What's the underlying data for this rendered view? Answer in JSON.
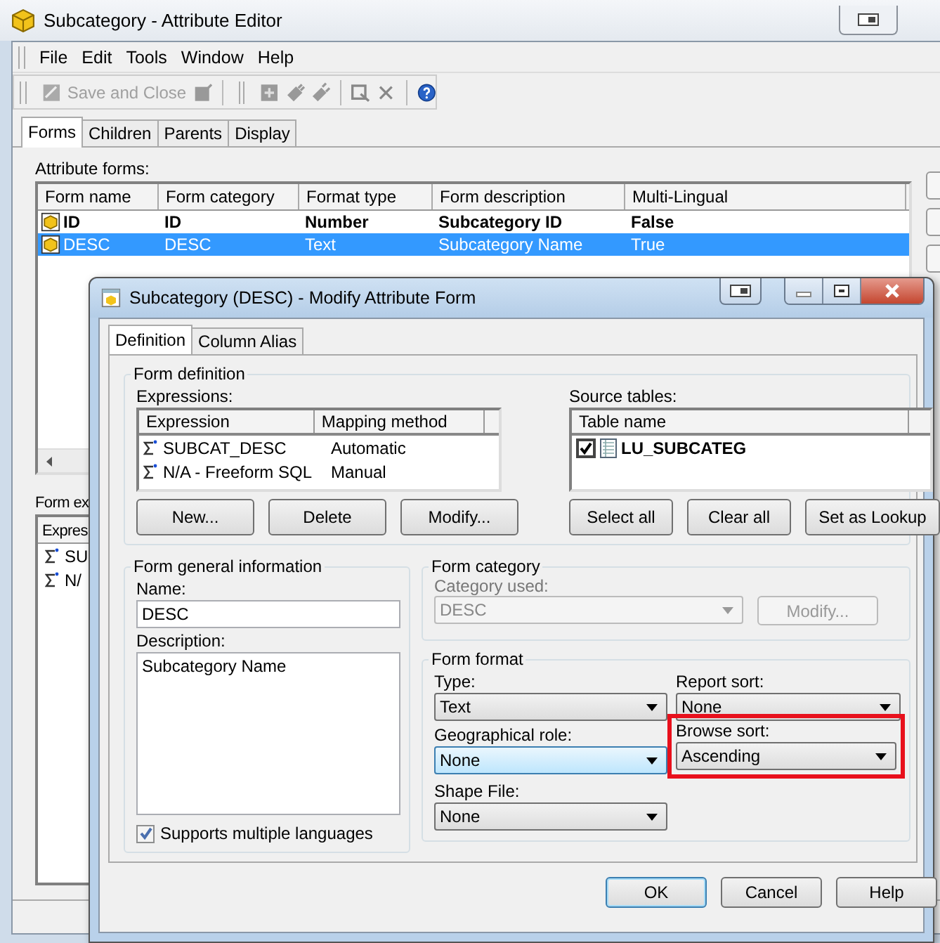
{
  "main_window": {
    "title": "Subcategory - Attribute Editor"
  },
  "menu": [
    "File",
    "Edit",
    "Tools",
    "Window",
    "Help"
  ],
  "toolbar": {
    "save_label": "Save and Close",
    "save_disabled": true
  },
  "tabs": [
    {
      "label": "Forms",
      "selected": true
    },
    {
      "label": "Children",
      "selected": false
    },
    {
      "label": "Parents",
      "selected": false
    },
    {
      "label": "Display",
      "selected": false
    }
  ],
  "attribute_forms": {
    "label": "Attribute forms:",
    "columns": [
      "Form name",
      "Form category",
      "Format type",
      "Form description",
      "Multi-Lingual"
    ],
    "rows": [
      {
        "cells": [
          "ID",
          "ID",
          "Number",
          "Subcategory ID",
          "False"
        ],
        "bold": true,
        "selected": false
      },
      {
        "cells": [
          "DESC",
          "DESC",
          "Text",
          "Subcategory Name",
          "True"
        ],
        "bold": false,
        "selected": true
      }
    ]
  },
  "form_expressions": {
    "label": "Form ex",
    "column": "Expres",
    "rows": [
      "SU",
      "N/"
    ]
  },
  "dialog": {
    "title": "Subcategory (DESC) - Modify Attribute Form",
    "tabs": [
      {
        "label": "Definition",
        "selected": true
      },
      {
        "label": "Column Alias",
        "selected": false
      }
    ],
    "form_definition": {
      "legend": "Form definition",
      "expressions_label": "Expressions:",
      "columns": [
        "Expression",
        "Mapping method"
      ],
      "rows": [
        {
          "expression": "SUBCAT_DESC",
          "method": "Automatic"
        },
        {
          "expression": "N/A - Freeform SQL",
          "method": "Manual"
        }
      ],
      "buttons": [
        "New...",
        "Delete",
        "Modify..."
      ],
      "source_label": "Source tables:",
      "source_column": "Table name",
      "tables": [
        {
          "name": "LU_SUBCATEG",
          "checked": true
        }
      ],
      "source_buttons": [
        "Select all",
        "Clear all",
        "Set as Lookup"
      ]
    },
    "general": {
      "legend": "Form general information",
      "name_label": "Name:",
      "name": "DESC",
      "description_label": "Description:",
      "description": "Subcategory Name",
      "multilang_label": "Supports multiple languages",
      "multilang_checked": true
    },
    "category": {
      "legend": "Form category",
      "label": "Category used:",
      "value": "DESC",
      "disabled": true,
      "button": "Modify..."
    },
    "format": {
      "legend": "Form format",
      "fields": [
        {
          "label": "Type:",
          "value": "Text",
          "focused": false,
          "highlighted": false
        },
        {
          "label": "Report sort:",
          "value": "None",
          "focused": false,
          "highlighted": false
        },
        {
          "label": "Geographical role:",
          "value": "None",
          "focused": true,
          "highlighted": false
        },
        {
          "label": "Browse sort:",
          "value": "Ascending",
          "focused": false,
          "highlighted": true
        },
        {
          "label": "Shape File:",
          "value": "None",
          "focused": false,
          "highlighted": false
        }
      ]
    },
    "buttons": [
      {
        "label": "OK",
        "default": true
      },
      {
        "label": "Cancel",
        "default": false
      },
      {
        "label": "Help",
        "default": false
      }
    ]
  }
}
